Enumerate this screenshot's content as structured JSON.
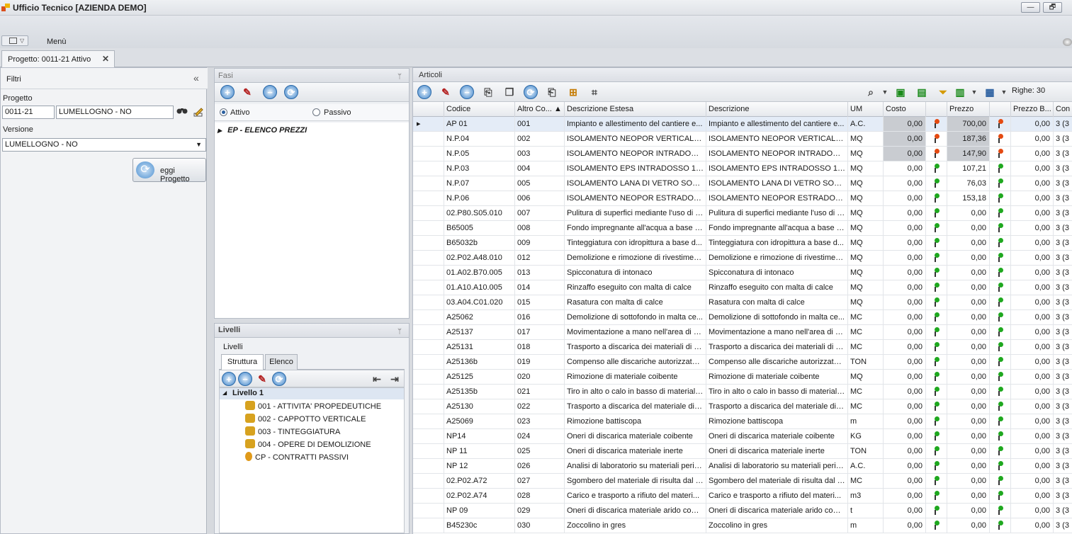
{
  "window": {
    "title": "Ufficio Tecnico [AZIENDA DEMO]",
    "controls": [
      "—",
      "🗗"
    ]
  },
  "menubar": {
    "label": "Menù"
  },
  "tab": {
    "label": "Progetto: 0011-21 Attivo",
    "close": "✕"
  },
  "filtri": {
    "header": "Filtri",
    "collapse": "«",
    "progetto_label": "Progetto",
    "progetto_code": "0011-21",
    "progetto_name": "LUMELLOGNO - NO",
    "versione_label": "Versione",
    "versione_value": "LUMELLOGNO - NO",
    "refresh_label": "eggi Progetto"
  },
  "fasi": {
    "header": "Fasi",
    "radio_attivo": "Attivo",
    "radio_passivo": "Passivo",
    "tree_item": "EP - ELENCO PREZZI"
  },
  "livelli": {
    "header": "Livelli",
    "subheader": "Livelli",
    "tab_struttura": "Struttura",
    "tab_elenco": "Elenco",
    "root": "Livello 1",
    "nodes": [
      "001 - ATTIVITA' PROPEDEUTICHE",
      "002 - CAPPOTTO VERTICALE",
      "003 - TINTEGGIATURA",
      "004 - OPERE DI DEMOLIZIONE",
      "CP - CONTRATTI PASSIVI"
    ]
  },
  "articoli": {
    "header": "Articoli",
    "righe": "Righe: 30",
    "columns": [
      "Codice",
      "Altro Co... ▲",
      "Descrizione Estesa",
      "Descrizione",
      "UM",
      "Costo",
      "",
      "Prezzo",
      "",
      "Prezzo B...",
      "Con"
    ],
    "rows": [
      {
        "codice": "AP 01",
        "altro": "001",
        "estesa": "Impianto e allestimento del cantiere e...",
        "descr": "Impianto e allestimento del cantiere e...",
        "um": "A.C.",
        "costo": "0,00",
        "prezzo": "700,00",
        "pb": "0,00",
        "con": "3 (3"
      },
      {
        "codice": "N.P.04",
        "altro": "002",
        "estesa": "ISOLAMENTO NEOPOR VERTICALE 16...",
        "descr": "ISOLAMENTO NEOPOR VERTICALE 16...",
        "um": "MQ",
        "costo": "0,00",
        "prezzo": "187,36",
        "pb": "0,00",
        "con": "3 (3"
      },
      {
        "codice": "N.P.05",
        "altro": "003",
        "estesa": "ISOLAMENTO NEOPOR INTRADOSSO ...",
        "descr": "ISOLAMENTO NEOPOR INTRADOSSO ...",
        "um": "MQ",
        "costo": "0,00",
        "prezzo": "147,90",
        "pb": "0,00",
        "con": "3 (3"
      },
      {
        "codice": "N.P.03",
        "altro": "004",
        "estesa": "ISOLAMENTO EPS INTRADOSSO 10 c...",
        "descr": "ISOLAMENTO EPS INTRADOSSO 10 c...",
        "um": "MQ",
        "costo": "0,00",
        "prezzo": "107,21",
        "pb": "0,00",
        "con": "3 (3"
      },
      {
        "codice": "N.P.07",
        "altro": "005",
        "estesa": "ISOLAMENTO LANA DI VETRO SOTTO...",
        "descr": "ISOLAMENTO LANA DI VETRO SOTTO...",
        "um": "MQ",
        "costo": "0,00",
        "prezzo": "76,03",
        "pb": "0,00",
        "con": "3 (3"
      },
      {
        "codice": "N.P.06",
        "altro": "006",
        "estesa": "ISOLAMENTO NEOPOR ESTRADOSSO...",
        "descr": "ISOLAMENTO NEOPOR ESTRADOSSO...",
        "um": "MQ",
        "costo": "0,00",
        "prezzo": "153,18",
        "pb": "0,00",
        "con": "3 (3"
      },
      {
        "codice": "02.P80.S05.010",
        "altro": "007",
        "estesa": "Pulitura di superfici mediante l'uso di s...",
        "descr": "Pulitura di superfici mediante l'uso di s...",
        "um": "MQ",
        "costo": "0,00",
        "prezzo": "0,00",
        "pb": "0,00",
        "con": "3 (3"
      },
      {
        "codice": "B65005",
        "altro": "008",
        "estesa": "Fondo impregnante all'acqua a base d...",
        "descr": "Fondo impregnante all'acqua a base d...",
        "um": "MQ",
        "costo": "0,00",
        "prezzo": "0,00",
        "pb": "0,00",
        "con": "3 (3"
      },
      {
        "codice": "B65032b",
        "altro": "009",
        "estesa": "Tinteggiatura con idropittura a base d...",
        "descr": "Tinteggiatura con idropittura a base d...",
        "um": "MQ",
        "costo": "0,00",
        "prezzo": "0,00",
        "pb": "0,00",
        "con": "3 (3"
      },
      {
        "codice": "02.P02.A48.010",
        "altro": "012",
        "estesa": "Demolizione e rimozione di rivestiment...",
        "descr": "Demolizione e rimozione di rivestiment...",
        "um": "MQ",
        "costo": "0,00",
        "prezzo": "0,00",
        "pb": "0,00",
        "con": "3 (3"
      },
      {
        "codice": "01.A02.B70.005",
        "altro": "013",
        "estesa": "Spicconatura di intonaco",
        "descr": "Spicconatura di intonaco",
        "um": "MQ",
        "costo": "0,00",
        "prezzo": "0,00",
        "pb": "0,00",
        "con": "3 (3"
      },
      {
        "codice": "01.A10.A10.005",
        "altro": "014",
        "estesa": "Rinzaffo eseguito con malta di calce",
        "descr": "Rinzaffo eseguito con malta di calce",
        "um": "MQ",
        "costo": "0,00",
        "prezzo": "0,00",
        "pb": "0,00",
        "con": "3 (3"
      },
      {
        "codice": "03.A04.C01.020",
        "altro": "015",
        "estesa": "Rasatura con malta di calce",
        "descr": "Rasatura con malta di calce",
        "um": "MQ",
        "costo": "0,00",
        "prezzo": "0,00",
        "pb": "0,00",
        "con": "3 (3"
      },
      {
        "codice": "A25062",
        "altro": "016",
        "estesa": "Demolizione di sottofondo in malta ce...",
        "descr": "Demolizione di sottofondo in malta ce...",
        "um": "MC",
        "costo": "0,00",
        "prezzo": "0,00",
        "pb": "0,00",
        "con": "3 (3"
      },
      {
        "codice": "A25137",
        "altro": "017",
        "estesa": "Movimentazione  a mano nell'area di c...",
        "descr": "Movimentazione  a mano nell'area di c...",
        "um": "MC",
        "costo": "0,00",
        "prezzo": "0,00",
        "pb": "0,00",
        "con": "3 (3"
      },
      {
        "codice": "A25131",
        "altro": "018",
        "estesa": "Trasporto a discarica dei materiali di ri...",
        "descr": "Trasporto a discarica dei materiali di ri...",
        "um": "MC",
        "costo": "0,00",
        "prezzo": "0,00",
        "pb": "0,00",
        "con": "3 (3"
      },
      {
        "codice": "A25136b",
        "altro": "019",
        "estesa": "Compenso alle discariche autorizzate ...",
        "descr": "Compenso alle discariche autorizzate ...",
        "um": "TON",
        "costo": "0,00",
        "prezzo": "0,00",
        "pb": "0,00",
        "con": "3 (3"
      },
      {
        "codice": "A25125",
        "altro": "020",
        "estesa": "Rimozione di materiale coibente",
        "descr": "Rimozione di materiale coibente",
        "um": "MQ",
        "costo": "0,00",
        "prezzo": "0,00",
        "pb": "0,00",
        "con": "3 (3"
      },
      {
        "codice": "A25135b",
        "altro": "021",
        "estesa": "Tiro in alto o calo in basso di materiali ...",
        "descr": "Tiro in alto o calo in basso di materiali ...",
        "um": "MC",
        "costo": "0,00",
        "prezzo": "0,00",
        "pb": "0,00",
        "con": "3 (3"
      },
      {
        "codice": "A25130",
        "altro": "022",
        "estesa": "Trasporto a discarica del materiale di r...",
        "descr": "Trasporto a discarica del materiale di r...",
        "um": "MC",
        "costo": "0,00",
        "prezzo": "0,00",
        "pb": "0,00",
        "con": "3 (3"
      },
      {
        "codice": "A25069",
        "altro": "023",
        "estesa": "Rimozione battiscopa",
        "descr": "Rimozione battiscopa",
        "um": "m",
        "costo": "0,00",
        "prezzo": "0,00",
        "pb": "0,00",
        "con": "3 (3"
      },
      {
        "codice": "NP14",
        "altro": "024",
        "estesa": "Oneri di discarica materiale coibente",
        "descr": "Oneri di discarica materiale coibente",
        "um": "KG",
        "costo": "0,00",
        "prezzo": "0,00",
        "pb": "0,00",
        "con": "3 (3"
      },
      {
        "codice": "NP 11",
        "altro": "025",
        "estesa": "Oneri di discarica materiale inerte",
        "descr": "Oneri di discarica materiale inerte",
        "um": "TON",
        "costo": "0,00",
        "prezzo": "0,00",
        "pb": "0,00",
        "con": "3 (3"
      },
      {
        "codice": "NP 12",
        "altro": "026",
        "estesa": "Analisi di laboratorio su materiali peric...",
        "descr": "Analisi di laboratorio su materiali peric...",
        "um": "A.C.",
        "costo": "0,00",
        "prezzo": "0,00",
        "pb": "0,00",
        "con": "3 (3"
      },
      {
        "codice": "02.P02.A72",
        "altro": "027",
        "estesa": "Sgombero del materiale di risulta dal l...",
        "descr": "Sgombero del materiale di risulta dal l...",
        "um": "MC",
        "costo": "0,00",
        "prezzo": "0,00",
        "pb": "0,00",
        "con": "3 (3"
      },
      {
        "codice": "02.P02.A74",
        "altro": "028",
        "estesa": "Carico e trasporto a rifiuto del materi...",
        "descr": "Carico e trasporto a rifiuto del materi...",
        "um": "m3",
        "costo": "0,00",
        "prezzo": "0,00",
        "pb": "0,00",
        "con": "3 (3"
      },
      {
        "codice": "NP 09",
        "altro": "029",
        "estesa": "Oneri di discarica materiale arido  com...",
        "descr": "Oneri di discarica materiale arido  com...",
        "um": "t",
        "costo": "0,00",
        "prezzo": "0,00",
        "pb": "0,00",
        "con": "3 (3"
      },
      {
        "codice": "B45230c",
        "altro": "030",
        "estesa": "Zoccolino in gres",
        "descr": "Zoccolino in gres",
        "um": "m",
        "costo": "0,00",
        "prezzo": "0,00",
        "pb": "0,00",
        "con": "3 (3"
      }
    ]
  }
}
